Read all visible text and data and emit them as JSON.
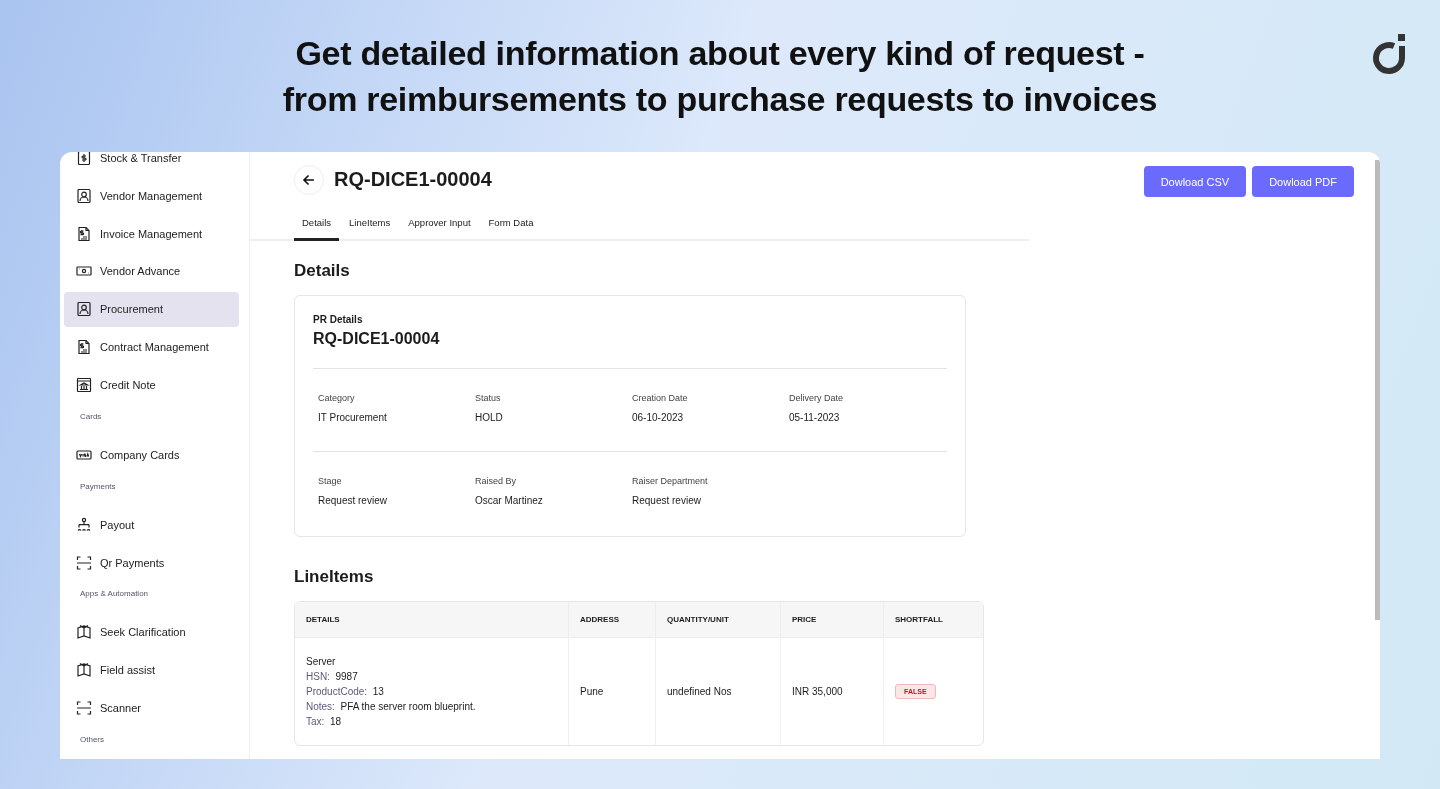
{
  "headline": [
    "Get detailed information about every kind of request -",
    "from reimbursements to purchase requests to invoices"
  ],
  "sidebar": {
    "items": [
      {
        "kind": "item",
        "label": "Stock & Transfer",
        "selected": false
      },
      {
        "kind": "item",
        "label": "Vendor Management",
        "selected": false
      },
      {
        "kind": "item",
        "label": "Invoice Management",
        "selected": false
      },
      {
        "kind": "item",
        "label": "Vendor Advance",
        "selected": false
      },
      {
        "kind": "item",
        "label": "Procurement",
        "selected": true
      },
      {
        "kind": "item",
        "label": "Contract Management",
        "selected": false
      },
      {
        "kind": "item",
        "label": "Credit Note",
        "selected": false
      },
      {
        "kind": "section",
        "label": "Cards"
      },
      {
        "kind": "item",
        "label": "Company Cards",
        "selected": false
      },
      {
        "kind": "section",
        "label": "Payments"
      },
      {
        "kind": "item",
        "label": "Payout",
        "selected": false
      },
      {
        "kind": "item",
        "label": "Qr Payments",
        "selected": false
      },
      {
        "kind": "section",
        "label": "Apps & Automation"
      },
      {
        "kind": "item",
        "label": "Seek Clarification",
        "selected": false
      },
      {
        "kind": "item",
        "label": "Field assist",
        "selected": false
      },
      {
        "kind": "item",
        "label": "Scanner",
        "selected": false
      },
      {
        "kind": "section",
        "label": "Others"
      }
    ]
  },
  "header": {
    "title": "RQ-DICE1-00004",
    "buttons": [
      "Dowload CSV",
      "Dowload PDF"
    ]
  },
  "tabs": [
    {
      "label": "Details",
      "selected": true
    },
    {
      "label": "LineItems",
      "selected": false
    },
    {
      "label": "Approver Input",
      "selected": false
    },
    {
      "label": "Form Data",
      "selected": false
    }
  ],
  "details": {
    "heading": "Details",
    "card_label": "PR Details",
    "card_title": "RQ-DICE1-00004",
    "field_rows": [
      [
        {
          "label": "Category",
          "value": "IT Procurement"
        },
        {
          "label": "Status",
          "value": "HOLD"
        },
        {
          "label": "Creation Date",
          "value": "06-10-2023"
        },
        {
          "label": "Delivery Date",
          "value": "05-11-2023"
        }
      ],
      [
        {
          "label": "Stage",
          "value": "Request review"
        },
        {
          "label": "Raised By",
          "value": "Oscar Martinez"
        },
        {
          "label": "Raiser Department",
          "value": "Request review"
        }
      ]
    ]
  },
  "line_items": {
    "heading": "LineItems",
    "columns": [
      "DETAILS",
      "ADDRESS",
      "QUANTITY/UNIT",
      "PRICE",
      "SHORTFALL"
    ],
    "rows": [
      {
        "name": "Server",
        "fields": [
          {
            "label": "HSN:",
            "value": "9987"
          },
          {
            "label": "ProductCode:",
            "value": "13"
          },
          {
            "label": "Notes:",
            "value": "PFA the server room blueprint."
          },
          {
            "label": "Tax:",
            "value": "18"
          }
        ],
        "address": "Pune",
        "quantity": "undefined Nos",
        "price": "INR 35,000",
        "shortfall": "FALSE"
      }
    ]
  }
}
